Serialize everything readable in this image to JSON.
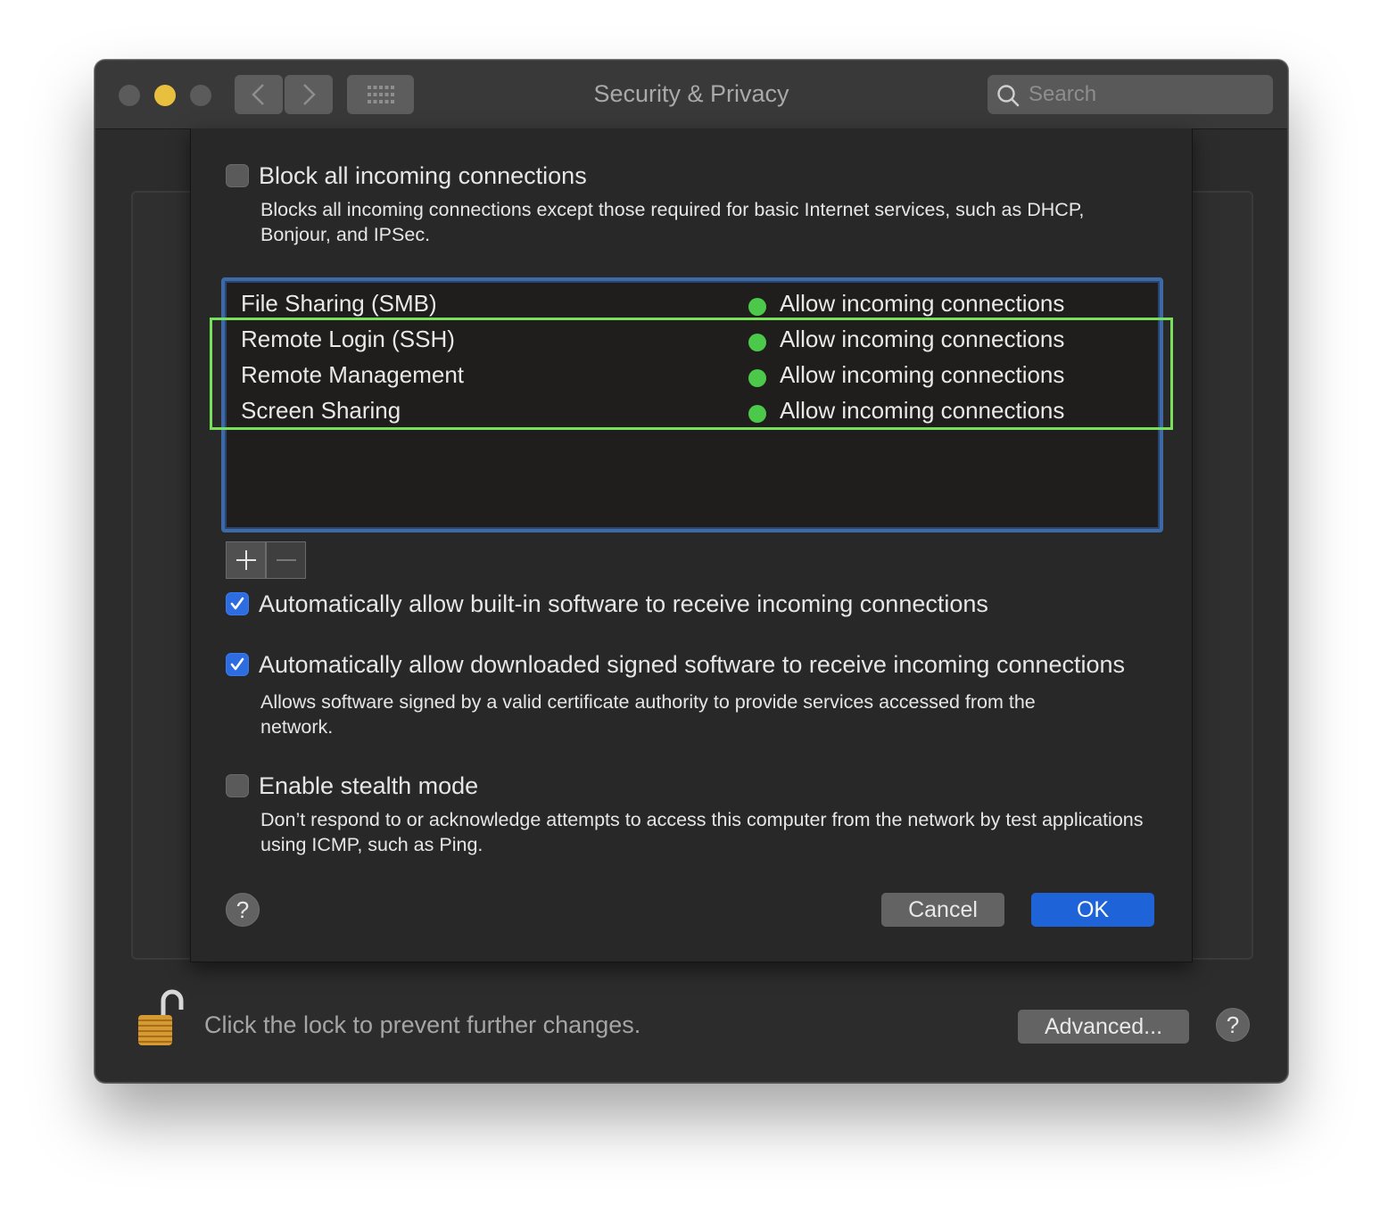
{
  "window": {
    "title": "Security & Privacy",
    "search_placeholder": "Search"
  },
  "firewall": {
    "block_all": {
      "label": "Block all incoming connections",
      "checked": false,
      "description": "Blocks all incoming connections except those required for basic Internet services, such as DHCP, Bonjour, and IPSec."
    },
    "services": [
      {
        "name": "File Sharing (SMB)",
        "status": "Allow incoming connections",
        "status_color": "#4cc84a"
      },
      {
        "name": "Remote Login (SSH)",
        "status": "Allow incoming connections",
        "status_color": "#4cc84a"
      },
      {
        "name": "Remote Management",
        "status": "Allow incoming connections",
        "status_color": "#4cc84a"
      },
      {
        "name": "Screen Sharing",
        "status": "Allow incoming connections",
        "status_color": "#4cc84a"
      }
    ],
    "auto_builtin": {
      "label": "Automatically allow built-in software to receive incoming connections",
      "checked": true
    },
    "auto_signed": {
      "label": "Automatically allow downloaded signed software to receive incoming connections",
      "checked": true,
      "description": "Allows software signed by a valid certificate authority to provide services accessed from the network."
    },
    "stealth": {
      "label": "Enable stealth mode",
      "checked": false,
      "description": "Don’t respond to or acknowledge attempts to access this computer from the network by test applications using ICMP, such as Ping."
    },
    "help_label": "?",
    "cancel_label": "Cancel",
    "ok_label": "OK"
  },
  "footer": {
    "lock_text": "Click the lock to prevent further changes.",
    "advanced_label": "Advanced...",
    "help_label": "?"
  },
  "colors": {
    "accent": "#2e6de1",
    "ok_button": "#1f63d8",
    "status_green": "#4cc84a",
    "highlight_outline": "#78e05a",
    "list_focus": "#3d6aa6"
  }
}
